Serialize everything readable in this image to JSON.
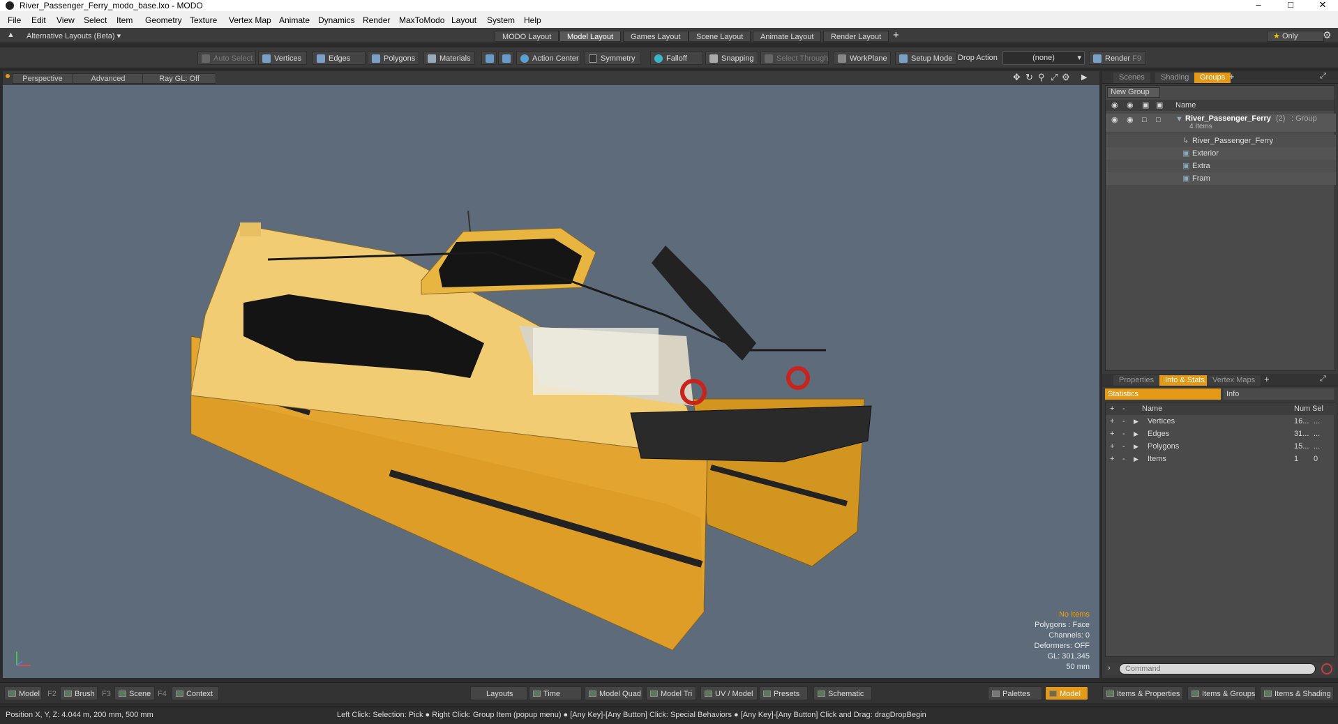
{
  "window": {
    "title": "River_Passenger_Ferry_modo_base.lxo - MODO"
  },
  "menu": [
    "File",
    "Edit",
    "View",
    "Select",
    "Item",
    "Geometry",
    "Texture",
    "Vertex Map",
    "Animate",
    "Dynamics",
    "Render",
    "MaxToModo",
    "Layout",
    "System",
    "Help"
  ],
  "layouts": {
    "alt_label": "Alternative Layouts (Beta)",
    "tabs": [
      "MODO Layout",
      "Model Layout",
      "Games Layout",
      "Scene Layout",
      "Animate Layout",
      "Render Layout"
    ],
    "active": "Model Layout",
    "add": "+",
    "only_label": "Only"
  },
  "toolbar": {
    "auto_select": "Auto Select",
    "vertices": "Vertices",
    "edges": "Edges",
    "polygons": "Polygons",
    "materials": "Materials",
    "action_center": "Action Center",
    "symmetry": "Symmetry",
    "falloff": "Falloff",
    "snapping": "Snapping",
    "select_through": "Select Through",
    "workplane": "WorkPlane",
    "setup_mode": "Setup Mode",
    "drop_action": "Drop Action",
    "drop_value": "(none)",
    "render": "Render",
    "render_key": "F9"
  },
  "viewport": {
    "view": "Perspective",
    "style": "Advanced",
    "raygl": "Ray GL: Off",
    "hud": {
      "no_items": "No Items",
      "polygons": "Polygons : Face",
      "channels": "Channels: 0",
      "deformers": "Deformers: OFF",
      "gl": "GL: 301,345",
      "scale": "50 mm"
    }
  },
  "colors": {
    "accent": "#e49a16",
    "hull": "#e0a02a",
    "viewport_bg": "#5d6b7a"
  },
  "groups_panel": {
    "tabs": [
      "Scenes",
      "Shading",
      "Groups"
    ],
    "active": "Groups",
    "new_group": "New Group",
    "name_header": "Name",
    "root": {
      "name": "River_Passenger_Ferry",
      "count": "(2)",
      "type": ": Group",
      "sub": "4 Items"
    },
    "children": [
      "River_Passenger_Ferry",
      "Exterior",
      "Extra",
      "Fram"
    ]
  },
  "info_panel": {
    "tabs": [
      "Properties",
      "Info & Stats",
      "Vertex Maps"
    ],
    "active": "Info & Stats",
    "subtabs": [
      "Statistics",
      "Info"
    ],
    "headers": {
      "name": "Name",
      "num": "Num",
      "sel": "Sel"
    },
    "rows": [
      {
        "name": "Vertices",
        "num": "16...",
        "sel": "..."
      },
      {
        "name": "Edges",
        "num": "31...",
        "sel": "..."
      },
      {
        "name": "Polygons",
        "num": "15...",
        "sel": "..."
      },
      {
        "name": "Items",
        "num": "1",
        "sel": "0"
      }
    ],
    "command_placeholder": "Command"
  },
  "bottom": {
    "model": "Model",
    "model_key": "F2",
    "brush": "Brush",
    "brush_key": "F3",
    "scene": "Scene",
    "scene_key": "F4",
    "context": "Context",
    "layouts": "Layouts",
    "time": "Time",
    "model_quad": "Model Quad",
    "model_tri": "Model Tri",
    "uv_model": "UV / Model",
    "presets": "Presets",
    "schematic": "Schematic",
    "palettes": "Palettes",
    "model_active": "Model",
    "items_properties": "Items & Properties",
    "items_groups": "Items & Groups",
    "items_shading": "Items & Shading"
  },
  "status": {
    "position": "Position X, Y, Z:   4.044 m, 200 mm, 500 mm",
    "hint": "Left Click: Selection: Pick ●  Right Click: Group Item (popup menu) ●  [Any Key]-[Any Button] Click: Special Behaviors ●  [Any Key]-[Any Button] Click and Drag: dragDropBegin"
  }
}
